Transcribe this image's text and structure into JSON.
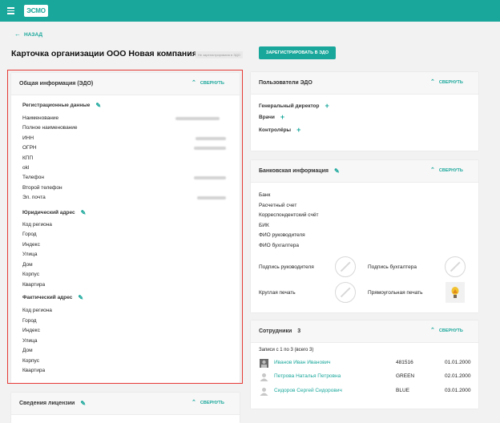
{
  "app": {
    "logo": "ЭСМО"
  },
  "nav": {
    "back_label": "НАЗАД"
  },
  "page": {
    "title": "Карточка организации ООО Новая компания",
    "status_badge": "Не зарегистрирована в ЭДО",
    "register_button": "ЗАРЕГИСТРИРОВАТЬ В ЭДО"
  },
  "collapse_label": "СВЕРНУТЬ",
  "general": {
    "title": "Общая информация (ЭДО)",
    "registration": {
      "title": "Регистрационные данные",
      "fields": [
        "Наименование",
        "Полное наименование",
        "ИНН",
        "ОГРН",
        "КПП",
        "okl",
        "Телефон",
        "Второй телефон",
        "Эл. почта"
      ]
    },
    "legal_address": {
      "title": "Юридический адрес",
      "fields": [
        "Код региона",
        "Город",
        "Индекс",
        "Улица",
        "Дом",
        "Корпус",
        "Квартира"
      ]
    },
    "actual_address": {
      "title": "Фактический адрес",
      "fields": [
        "Код региона",
        "Город",
        "Индекс",
        "Улица",
        "Дом",
        "Корпус",
        "Квартира"
      ]
    }
  },
  "license": {
    "title": "Сведения лицензии"
  },
  "edo_users": {
    "title": "Пользователи ЭДО",
    "roles": [
      "Генеральный директор",
      "Врачи",
      "Контролёры"
    ]
  },
  "bank": {
    "title": "Банковская информация",
    "fields": [
      "Банк",
      "Расчетный счет",
      "Корреспондентский счёт",
      "БИК",
      "ФИО руководителя",
      "ФИО бухгалтера"
    ],
    "sign_director": "Подпись руководителя",
    "sign_accountant": "Подпись бухгалтера",
    "round_stamp": "Круглая печать",
    "rect_stamp": "Прямоугольная печать"
  },
  "employees": {
    "title": "Сотрудники",
    "count": "3",
    "records_info": "Записи с 1 по 3 (всего 3)",
    "rows": [
      {
        "name": "Иванов Иван Иванович",
        "code": "481516",
        "date": "01.01.2000"
      },
      {
        "name": "Петрова Наталья Петровна",
        "code": "GREEN",
        "date": "02.01.2000"
      },
      {
        "name": "Сидоров Сергей Сидорович",
        "code": "BLUE",
        "date": "03.01.2000"
      }
    ]
  }
}
